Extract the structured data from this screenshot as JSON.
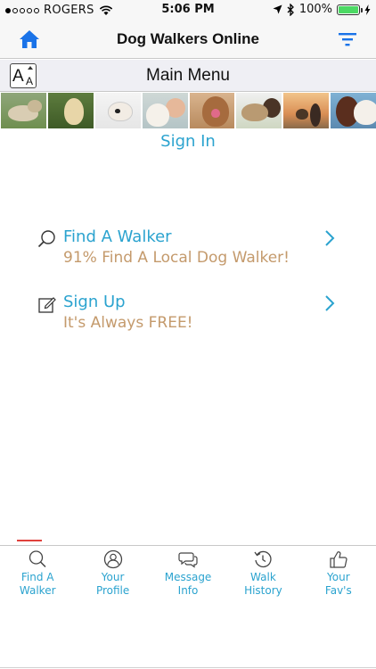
{
  "status_bar": {
    "carrier": "ROGERS",
    "time": "5:06 PM",
    "battery": "100%",
    "signal_bars": 1
  },
  "nav": {
    "title": "Dog Walkers Online",
    "home_icon": "home-icon",
    "filter_icon": "filter-icon"
  },
  "menu_header": {
    "title": "Main Menu",
    "font_button_big": "A",
    "font_button_small": "A"
  },
  "sign_in": "Sign In",
  "menu_items": [
    {
      "title": "Find A Walker",
      "subtitle": "91% Find A Local Dog Walker!",
      "icon": "search-icon"
    },
    {
      "title": "Sign Up",
      "subtitle": "It's Always FREE!",
      "icon": "edit-icon"
    }
  ],
  "tabs": [
    {
      "line1": "Find A",
      "line2": "Walker",
      "icon": "search-icon"
    },
    {
      "line1": "Your",
      "line2": "Profile",
      "icon": "user-icon"
    },
    {
      "line1": "Message",
      "line2": "Info",
      "icon": "message-icon"
    },
    {
      "line1": "Walk",
      "line2": "History",
      "icon": "history-icon"
    },
    {
      "line1": "Your",
      "line2": "Fav's",
      "icon": "thumbs-up-icon"
    }
  ],
  "colors": {
    "accent_blue": "#2ba3cf",
    "subtitle_tan": "#c49a6c",
    "nav_icon_blue": "#1a73e8",
    "tab_indicator_red": "#e0413c",
    "battery_green": "#4cd964"
  }
}
